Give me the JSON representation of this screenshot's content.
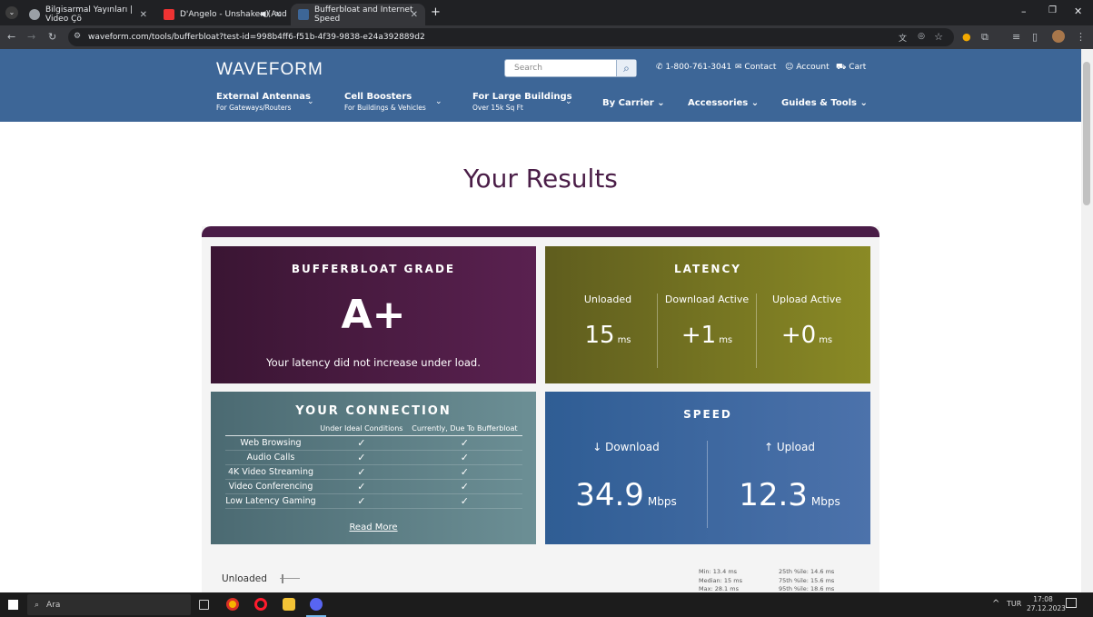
{
  "browser": {
    "tabs": [
      {
        "title": "Bilgisarmal Yayınları | Video Çö",
        "active": false
      },
      {
        "title": "D'Angelo - Unshaken (Aud",
        "active": false
      },
      {
        "title": "Bufferbloat and Internet Speed",
        "active": true
      }
    ],
    "url": "waveform.com/tools/bufferbloat?test-id=998b4ff6-f51b-4f39-9838-e24a392889d2",
    "new_tab": "+"
  },
  "site": {
    "logo": "WAVEFORM",
    "search_placeholder": "Search",
    "phone": "1-800-761-3041",
    "contact": "Contact",
    "account": "Account",
    "cart": "Cart",
    "nav": [
      {
        "title": "External Antennas",
        "sub": "For Gateways/Routers"
      },
      {
        "title": "Cell Boosters",
        "sub": "For Buildings & Vehicles"
      },
      {
        "title": "For Large Buildings",
        "sub": "Over 15k Sq Ft"
      },
      {
        "title": "By Carrier",
        "sub": ""
      },
      {
        "title": "Accessories",
        "sub": ""
      },
      {
        "title": "Guides & Tools",
        "sub": ""
      }
    ]
  },
  "results": {
    "title": "Your Results",
    "grade": {
      "heading": "BUFFERBLOAT GRADE",
      "value": "A+",
      "note": "Your latency did not increase under load."
    },
    "latency": {
      "heading": "LATENCY",
      "columns": [
        {
          "label": "Unloaded",
          "value": "15",
          "unit": "ms"
        },
        {
          "label": "Download Active",
          "value": "+1",
          "unit": "ms"
        },
        {
          "label": "Upload Active",
          "value": "+0",
          "unit": "ms"
        }
      ]
    },
    "connection": {
      "heading": "YOUR CONNECTION",
      "col_ideal": "Under Ideal Conditions",
      "col_current": "Currently, Due To Bufferbloat",
      "rows": [
        "Web Browsing",
        "Audio Calls",
        "4K Video Streaming",
        "Video Conferencing",
        "Low Latency Gaming"
      ],
      "check": "✓",
      "read_more": "Read More"
    },
    "speed": {
      "heading": "SPEED",
      "download_label": "↓ Download",
      "download_value": "34.9",
      "upload_label": "↑ Upload",
      "upload_value": "12.3",
      "unit": "Mbps"
    },
    "unloaded_label": "Unloaded",
    "stats_left": [
      "Min: 13.4 ms",
      "Median: 15 ms",
      "Max: 28.1 ms"
    ],
    "stats_right": [
      "25th %ile: 14.6 ms",
      "75th %ile: 15.6 ms",
      "95th %ile: 18.6 ms"
    ]
  },
  "taskbar": {
    "search": "Ara",
    "lang": "TUR",
    "time": "17:08",
    "date": "27.12.2023"
  }
}
